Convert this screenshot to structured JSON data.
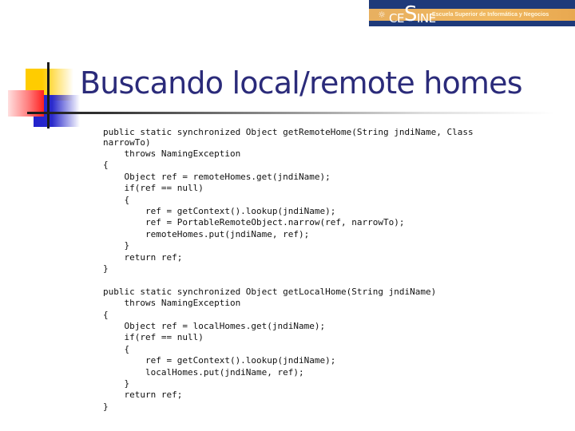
{
  "header": {
    "logo": {
      "emblem_icon": "globe-emblem-icon",
      "brand_prefix": "CE",
      "brand_s": "S",
      "brand_suffix": "INE",
      "subtitle": "Escuela Superior de Informática y Negocios",
      "colors": {
        "background": "#1e3a7a",
        "stripe": "#f0b860",
        "text": "#ffffff"
      }
    }
  },
  "slide": {
    "title": "Buscando local/remote homes",
    "title_color": "#2b2b7a",
    "decoration_colors": {
      "yellow": "#ffcc00",
      "blue": "#2222cc",
      "red": "#ff2020",
      "line": "#1a1a1a"
    }
  },
  "code": {
    "lines": [
      "public static synchronized Object getRemoteHome(String jndiName, Class",
      "narrowTo)",
      "    throws NamingException",
      "{",
      "    Object ref = remoteHomes.get(jndiName);",
      "    if(ref == null)",
      "    {",
      "        ref = getContext().lookup(jndiName);",
      "        ref = PortableRemoteObject.narrow(ref, narrowTo);",
      "        remoteHomes.put(jndiName, ref);",
      "    }",
      "    return ref;",
      "}",
      "",
      "public static synchronized Object getLocalHome(String jndiName)",
      "    throws NamingException",
      "{",
      "    Object ref = localHomes.get(jndiName);",
      "    if(ref == null)",
      "    {",
      "        ref = getContext().lookup(jndiName);",
      "        localHomes.put(jndiName, ref);",
      "    }",
      "    return ref;",
      "}"
    ]
  }
}
